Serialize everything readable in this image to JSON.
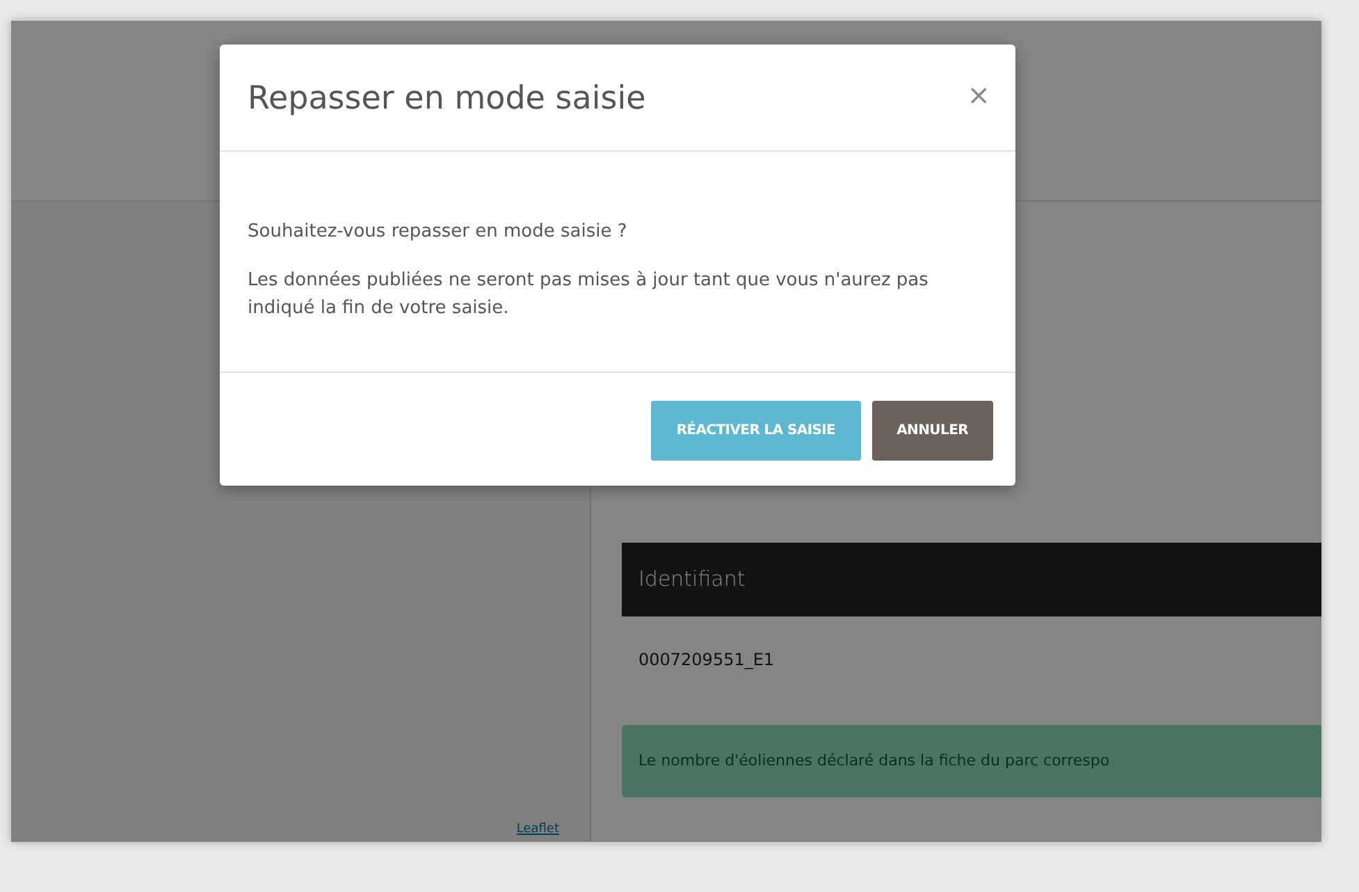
{
  "modal": {
    "title": "Repasser en mode saisie",
    "close": "×",
    "paragraphs": [
      "Souhaitez-vous repasser en mode saisie ?",
      "Les données publiées ne seront pas mises à jour tant que vous n'aurez pas indiqué la fin de votre saisie."
    ],
    "buttons": [
      {
        "label": "RÉACTIVER LA SAISIE",
        "kind": "primary"
      },
      {
        "label": "ANNULER",
        "kind": "secondary"
      }
    ]
  },
  "map": {
    "attribution": "Leaflet"
  },
  "panel": {
    "table": {
      "columns": [
        "Identifiant"
      ],
      "rows": [
        [
          "0007209551_E1"
        ]
      ]
    },
    "alert": {
      "text": "Le nombre d'éoliennes déclaré dans la fiche du parc correspo"
    }
  }
}
